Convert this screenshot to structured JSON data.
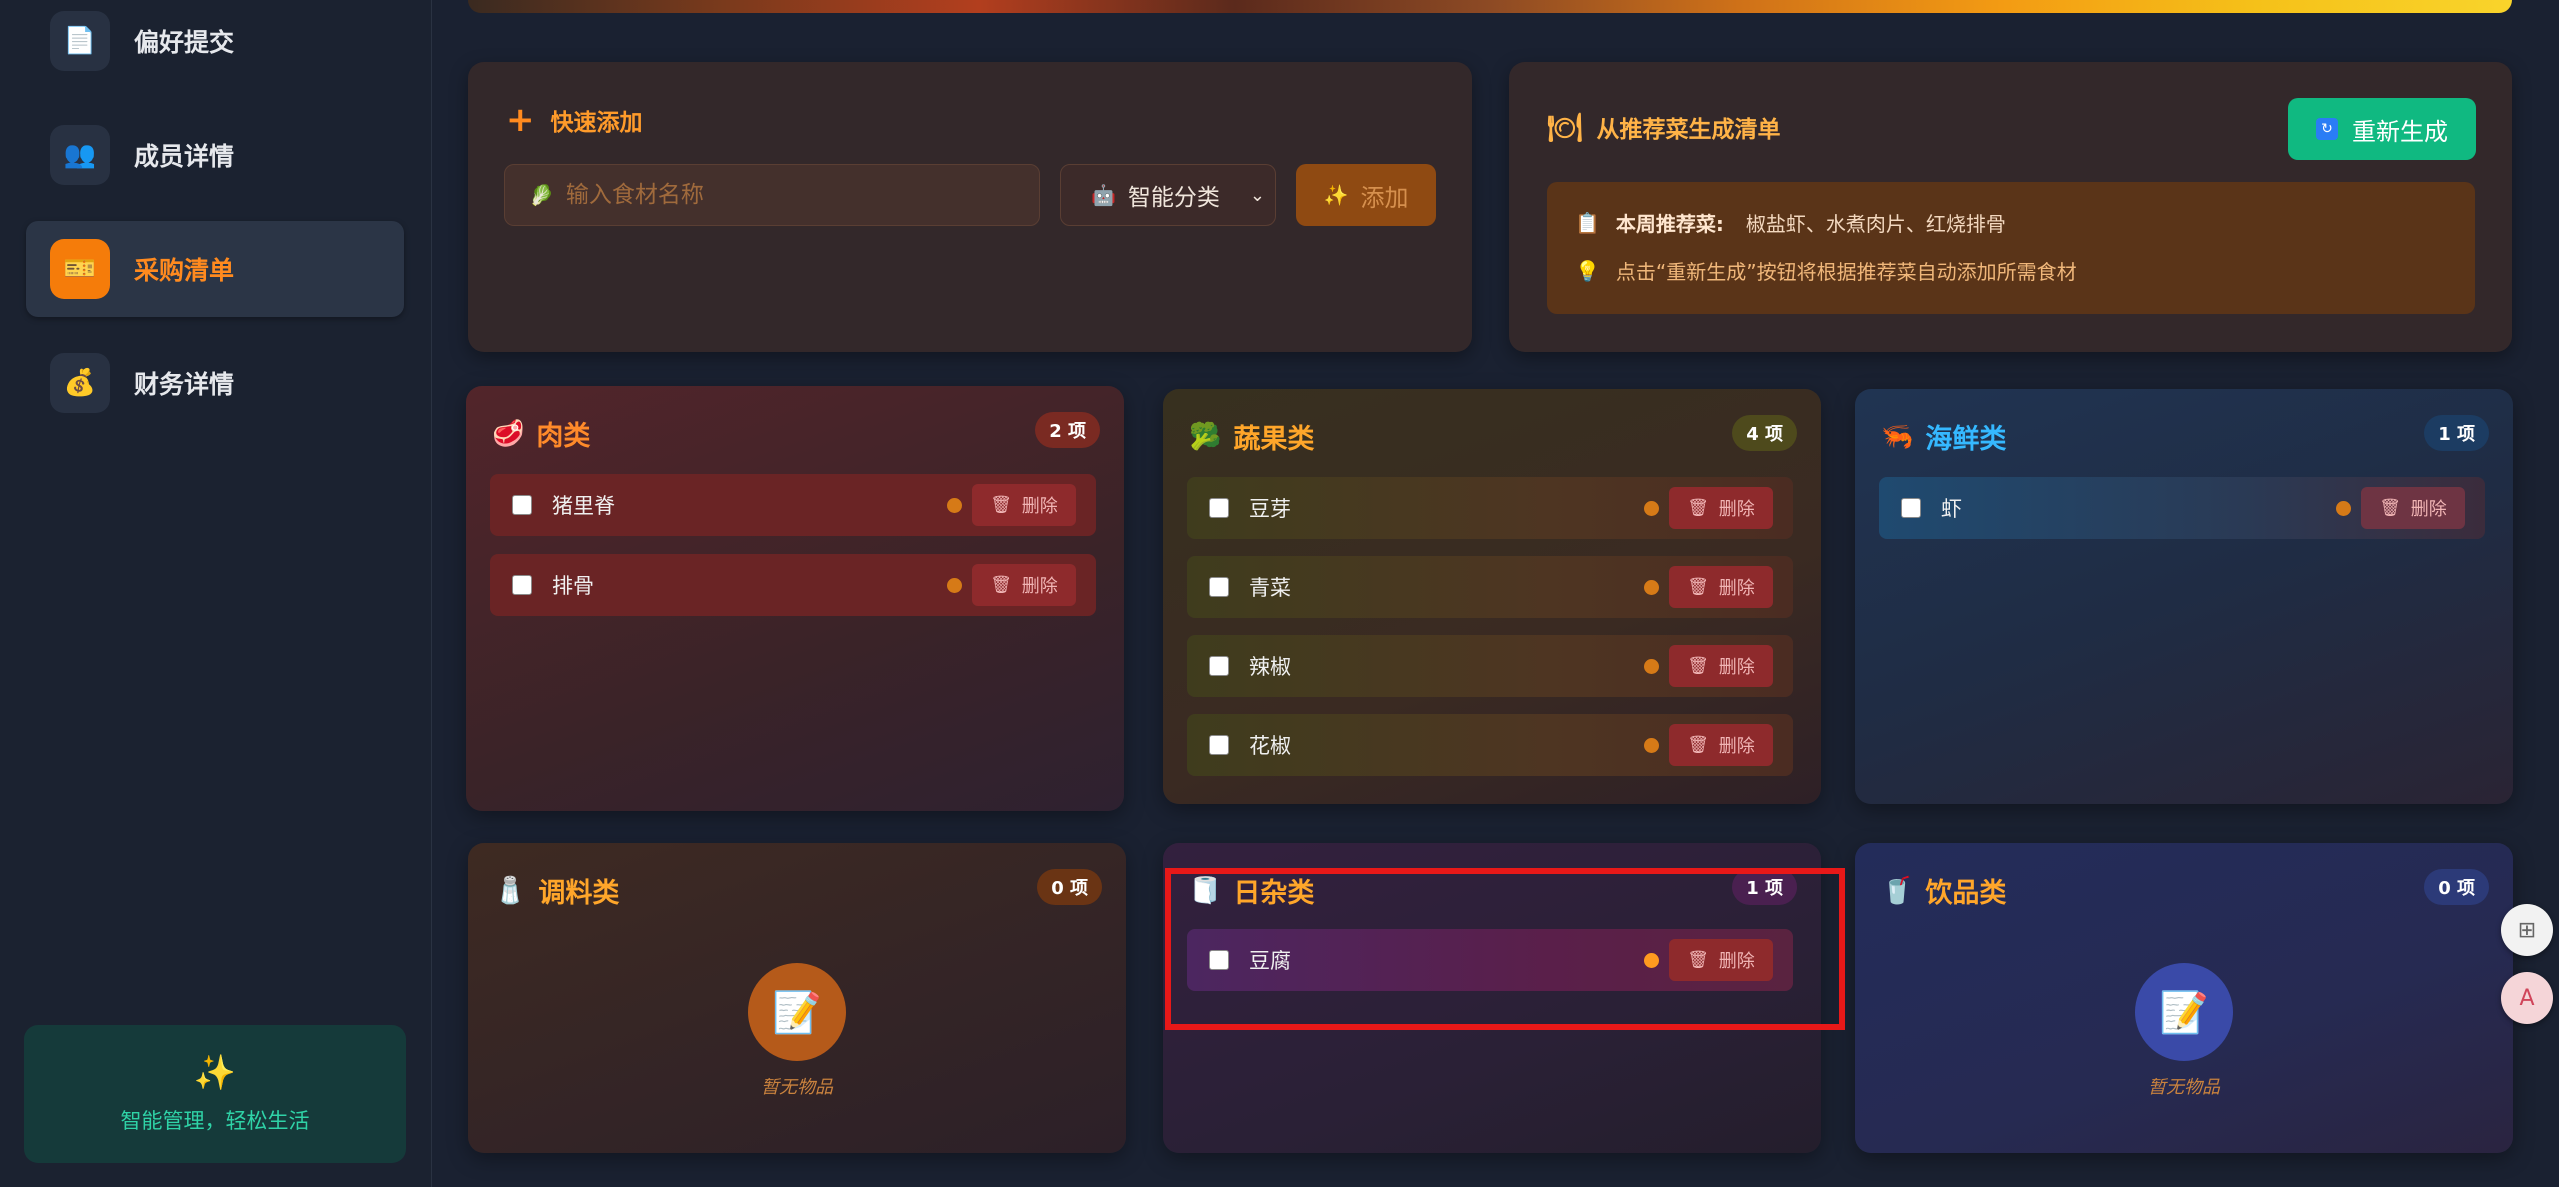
{
  "sidebar": {
    "items": [
      {
        "label": "偏好提交",
        "icon": "document-icon",
        "glyph": "📄"
      },
      {
        "label": "成员详情",
        "icon": "members-icon",
        "glyph": "👥"
      },
      {
        "label": "采购清单",
        "icon": "ticket-icon",
        "glyph": "🎫",
        "active": true
      },
      {
        "label": "财务详情",
        "icon": "money-bag-icon",
        "glyph": "💰"
      }
    ],
    "footer": {
      "icon": "✨",
      "text": "智能管理，轻松生活"
    }
  },
  "quick_add": {
    "title": "快速添加",
    "input_placeholder": "输入食材名称",
    "input_icon": "🥬",
    "category_select": "智能分类",
    "category_icon": "🤖",
    "add_label": "添加",
    "add_icon": "✨"
  },
  "recommend": {
    "title": "从推荐菜生成清单",
    "title_icon": "🍽",
    "regen_label": "重新生成",
    "regen_icon": "🔄",
    "weekly_label": "本周推荐菜:",
    "weekly_icon": "📋",
    "weekly_dishes": "椒盐虾、水煮肉片、红烧排骨",
    "hint_icon": "💡",
    "hint": "点击“重新生成”按钮将根据推荐菜自动添加所需食材"
  },
  "categories": {
    "meat": {
      "name": "肉类",
      "icon": "🥩",
      "count": "2 项",
      "color": "#ff8a2a",
      "items": [
        "猪里脊",
        "排骨"
      ]
    },
    "veg": {
      "name": "蔬果类",
      "icon": "🥦",
      "count": "4 项",
      "color": "#ffa62a",
      "items": [
        "豆芽",
        "青菜",
        "辣椒",
        "花椒"
      ]
    },
    "seafood": {
      "name": "海鲜类",
      "icon": "🦐",
      "count": "1 项",
      "color": "#35b8ff",
      "items": [
        "虾"
      ]
    },
    "spice": {
      "name": "调料类",
      "icon": "🧂",
      "count": "0 项",
      "color": "#ffa62a",
      "items": [],
      "empty_text": "暂无物品"
    },
    "daily": {
      "name": "日杂类",
      "icon": "🧻",
      "count": "1 项",
      "color": "#ffa62a",
      "items": [
        "豆腐"
      ]
    },
    "drink": {
      "name": "饮品类",
      "icon": "🥤",
      "count": "0 项",
      "color": "#ffa62a",
      "items": [],
      "empty_text": "暂无物品"
    }
  },
  "delete_label": "删除",
  "delete_icon": "🗑",
  "float_buttons": [
    {
      "icon": "apps-icon",
      "glyph": "⊞"
    },
    {
      "icon": "translate-icon",
      "glyph": "A"
    }
  ]
}
